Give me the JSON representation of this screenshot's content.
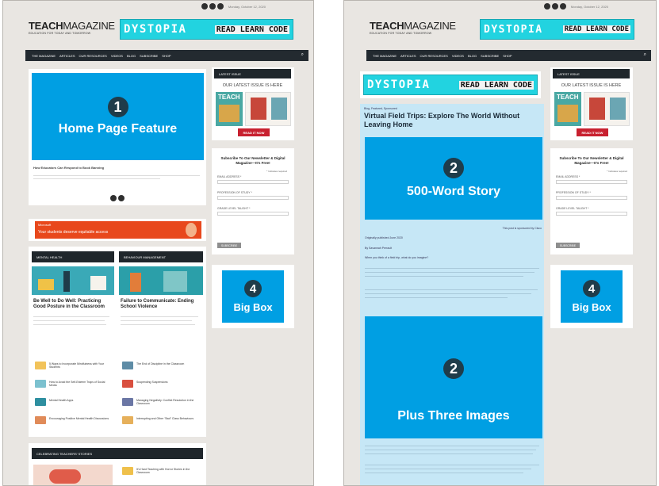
{
  "header": {
    "logo_main": "TEACH",
    "logo_suffix": "MAGAZINE",
    "tagline": "EDUCATION FOR TODAY AND TOMORROW",
    "date": "Monday, October 12, 2020"
  },
  "banner": {
    "word1": "DYSTOPIA",
    "word2": "READ LEARN CODE"
  },
  "nav": {
    "items": [
      "THE MAGAZINE",
      "ARTICLES",
      "OUR RESOURCES",
      "VIDEOS",
      "BLOG",
      "SUBSCRIBE",
      "SHOP"
    ]
  },
  "sidebar": {
    "latest_issue_title": "LATEST ISSUE",
    "latest_issue_sub": "OUR LATEST ISSUE IS HERE",
    "cover_title": "TEACH",
    "read_button": "READ IT NOW",
    "newsletter_title": "Subscribe To Our Newsletter & Digital Magazine—It's Free!",
    "required_note": "* Indicates required",
    "email_label": "EMAIL ADDRESS *",
    "prof_label": "PROFESSION OF STUDY *",
    "grade_label": "GRADE LEVEL TAUGHT *",
    "subscribe_button": "SUBSCRIBE"
  },
  "left": {
    "feature_number": "1",
    "feature_label": "Home Page Feature",
    "feature_caption": "How Educators Can Respond to Book Banning",
    "ad_brand": "Microsoft",
    "ad_text": "Your students deserve equitable access",
    "col1_header": "MENTAL HEALTH",
    "col2_header": "BEHAVIOUR MANAGEMENT",
    "col1_headline": "Be Well to Do Well: Practicing Good Posture in the Classroom",
    "col2_headline": "Failure to Communicate: Ending School Violence",
    "col1_items": [
      "5 Ways to Incorporate Mindfulness with Your Students",
      "How to Avoid the Self-Esteem Traps of Social Media",
      "Mental Health Apps",
      "Encouraging Positive Mental Health Discussions"
    ],
    "col2_items": [
      "The End of Discipline in the Classroom",
      "Suspending Suspensions",
      "Managing Negativity: Conflict Resolution in the Classroom",
      "Interrupting and Other \"Bad\" Class Behaviours"
    ],
    "celebrating_header": "CELEBRATING TEACHERS' STORIES",
    "celebrating_item": "It's Hard Teaching with Horror Stories in the Classroom",
    "bigbox_number": "4",
    "bigbox_label": "Big Box"
  },
  "right": {
    "kicker": "Blog, Featured, Sponsored",
    "headline": "Virtual Field Trips: Explore The World Without Leaving Home",
    "story_number": "2",
    "story_label": "500-Word Story",
    "sponsor_note": "This post is sponsored by Cisco",
    "published": "Originally published June 2020",
    "byline": "By Savannah Perrault",
    "intro": "When you think of a field trip, what do you imagine?",
    "images_number": "2",
    "images_label": "Plus Three Images",
    "bigbox_number": "4",
    "bigbox_label": "Big Box"
  },
  "colors": {
    "zone_blue": "#009fe3",
    "nav_dark": "#232a30",
    "banner_cyan": "#22d3e0",
    "badge_dark": "#1f3c4a"
  }
}
